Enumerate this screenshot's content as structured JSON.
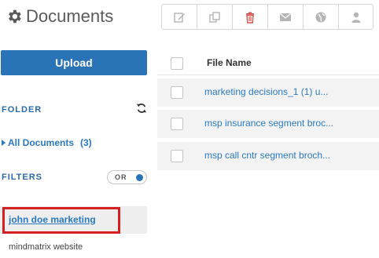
{
  "header": {
    "title": "Documents",
    "title_icon": "gear-icon"
  },
  "toolbar": {
    "buttons": [
      {
        "icon": "edit-icon"
      },
      {
        "icon": "copy-icon"
      },
      {
        "icon": "trash-icon",
        "color": "#d9534f"
      },
      {
        "icon": "envelope-icon"
      },
      {
        "icon": "globe-icon"
      },
      {
        "icon": "user-icon"
      }
    ]
  },
  "sidebar": {
    "upload_label": "Upload",
    "folder_label": "FOLDER",
    "all_documents_label": "All Documents",
    "all_documents_count": "(3)",
    "filters_label": "FILTERS",
    "toggle_label": "OR",
    "filters": [
      {
        "label": "john doe marketing",
        "active": true
      },
      {
        "label": "mindmatrix website",
        "active": false
      }
    ]
  },
  "files": {
    "column_header": "File Name",
    "rows": [
      {
        "name": "marketing decisions_1 (1) u..."
      },
      {
        "name": "msp insurance segment broc..."
      },
      {
        "name": "msp call cntr segment broch..."
      }
    ]
  },
  "colors": {
    "primary": "#2a73b7",
    "link": "#2b79c2",
    "highlight": "#d42020"
  }
}
